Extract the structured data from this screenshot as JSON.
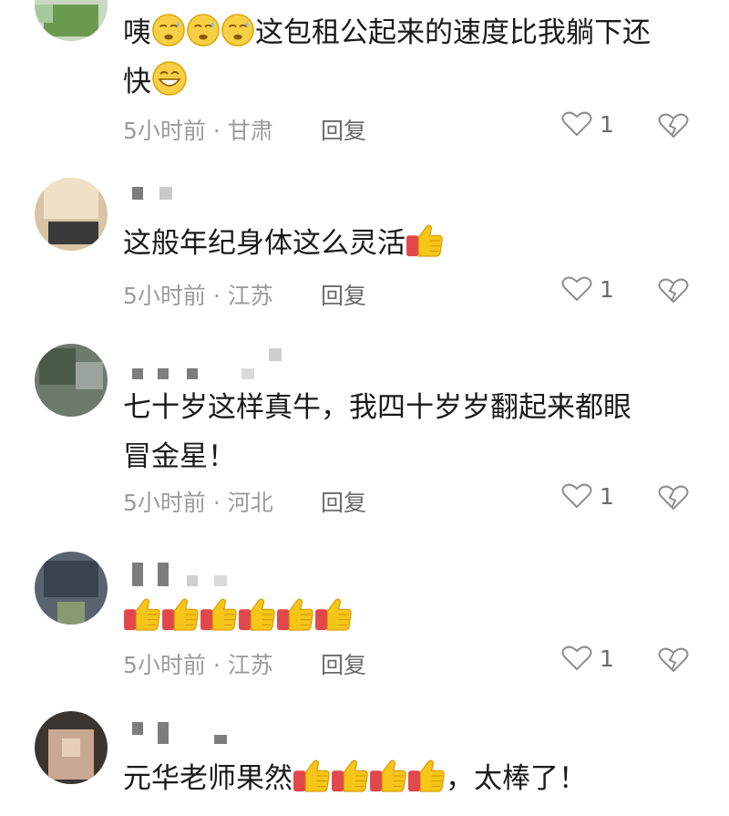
{
  "comments": [
    {
      "text_lines": [
        "咦",
        "这包租公起来的速度比我躺下还",
        "快"
      ],
      "time": "5小时前 · 甘肃",
      "reply": "回复",
      "likes": "1"
    },
    {
      "text": "这般年纪身体这么灵活",
      "time": "5小时前 · 江苏",
      "reply": "回复",
      "likes": "1"
    },
    {
      "text_line1": "七十岁这样真牛，我四十岁岁翻起来都眼",
      "text_line2": "冒金星！",
      "time": "5小时前 · 河北",
      "reply": "回复",
      "likes": "1"
    },
    {
      "time": "5小时前 · 江苏",
      "reply": "回复",
      "likes": "1"
    },
    {
      "text_before": "元华老师果然",
      "text_after": "，太棒了！"
    }
  ],
  "icons": {
    "smile_emoji": "sweat-smile-emoji",
    "grin_emoji": "grin-emoji",
    "thumb_emoji": "thumbs-up-emoji",
    "like": "heart-outline-icon",
    "dislike": "broken-heart-icon"
  },
  "colors": {
    "text": "#1a1a1a",
    "meta": "#9b9b9b",
    "emoji_yellow": "#f5c518",
    "emoji_red": "#e2474b"
  }
}
